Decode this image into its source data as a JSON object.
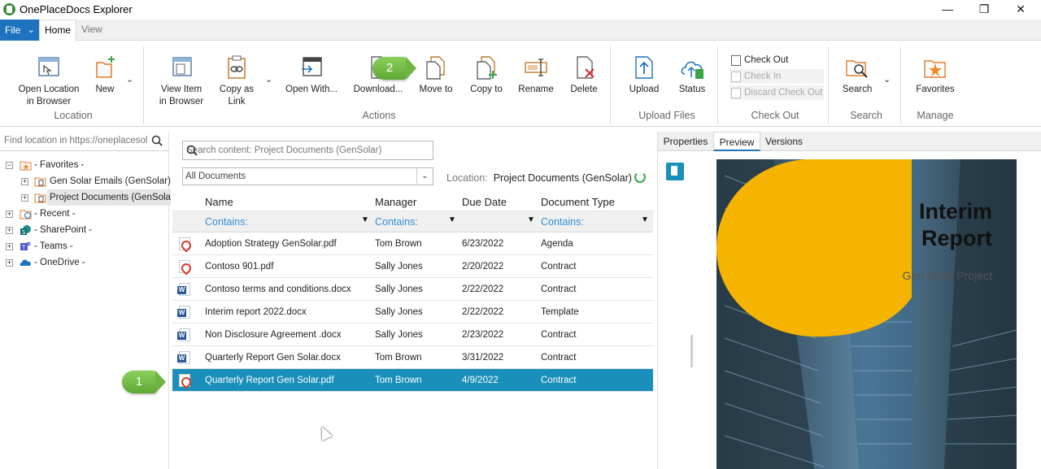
{
  "window": {
    "title": "OnePlaceDocs Explorer"
  },
  "tabs": {
    "file": "File",
    "home": "Home",
    "view": "View"
  },
  "ribbon": {
    "location": {
      "open_location": "Open Location",
      "open_location_2": "in Browser",
      "new": "New",
      "group": "Location"
    },
    "actions": {
      "view_item": "View Item",
      "view_item_2": "in Browser",
      "copy_link": "Copy as",
      "copy_link_2": "Link",
      "open_with": "Open With...",
      "download": "Download...",
      "move_to": "Move to",
      "copy_to": "Copy to",
      "rename": "Rename",
      "delete": "Delete",
      "group": "Actions"
    },
    "upload": {
      "upload": "Upload",
      "status": "Status",
      "group": "Upload Files"
    },
    "checkout": {
      "check_out": "Check Out",
      "check_in": "Check In",
      "discard": "Discard Check Out",
      "group": "Check Out"
    },
    "search": {
      "search": "Search",
      "group": "Search"
    },
    "manage": {
      "favorites": "Favorites",
      "group": "Manage"
    }
  },
  "left": {
    "search_placeholder": "Find location in https://oneplacesoluti",
    "tree": {
      "favorites": "- Favorites -",
      "gen_solar_emails": "Gen Solar Emails (GenSolar)",
      "project_documents": "Project Documents (GenSolar)",
      "recent": "- Recent -",
      "sharepoint": "- SharePoint -",
      "teams": "- Teams -",
      "onedrive": "- OneDrive -"
    }
  },
  "center": {
    "search_placeholder": "Search content: Project Documents (GenSolar)",
    "view_selected": "All Documents",
    "location_label": "Location:",
    "location_value": "Project Documents (GenSolar)",
    "columns": {
      "name": "Name",
      "manager": "Manager",
      "due": "Due Date",
      "type": "Document Type"
    },
    "filter_text": "Contains:",
    "rows": [
      {
        "name": "Adoption Strategy GenSolar.pdf",
        "manager": "Tom Brown",
        "due": "6/23/2022",
        "type": "Agenda",
        "icon": "pdf-icon"
      },
      {
        "name": "Contoso 901.pdf",
        "manager": "Sally Jones",
        "due": "2/20/2022",
        "type": "Contract",
        "icon": "pdf-icon"
      },
      {
        "name": "Contoso terms and conditions.docx",
        "manager": "Sally Jones",
        "due": "2/22/2022",
        "type": "Contract",
        "icon": "word-icon"
      },
      {
        "name": "Interim report 2022.docx",
        "manager": "Sally Jones",
        "due": "2/22/2022",
        "type": "Template",
        "icon": "word-icon"
      },
      {
        "name": "Non Disclosure Agreement .docx",
        "manager": "Sally Jones",
        "due": "2/23/2022",
        "type": "Contract",
        "icon": "word-icon"
      },
      {
        "name": "Quarterly Report Gen Solar.docx",
        "manager": "Tom Brown",
        "due": "3/31/2022",
        "type": "Contract",
        "icon": "word-icon"
      },
      {
        "name": "Quarterly Report Gen Solar.pdf",
        "manager": "Tom Brown",
        "due": "4/9/2022",
        "type": "Contract",
        "icon": "pdf-icon",
        "selected": true
      }
    ],
    "callout_1": "1",
    "callout_2": "2"
  },
  "right": {
    "tabs": {
      "properties": "Properties",
      "preview": "Preview",
      "versions": "Versions"
    },
    "cover": {
      "title_1": "Interim",
      "title_2": "Report",
      "subtitle": "Gen Solar Project"
    }
  },
  "colors": {
    "accent": "#1e73be",
    "selected_row": "#1a8fba",
    "filter_text": "#2f8fd8",
    "cover_yellow": "#f5b400",
    "callout_green": "#6fb543"
  }
}
